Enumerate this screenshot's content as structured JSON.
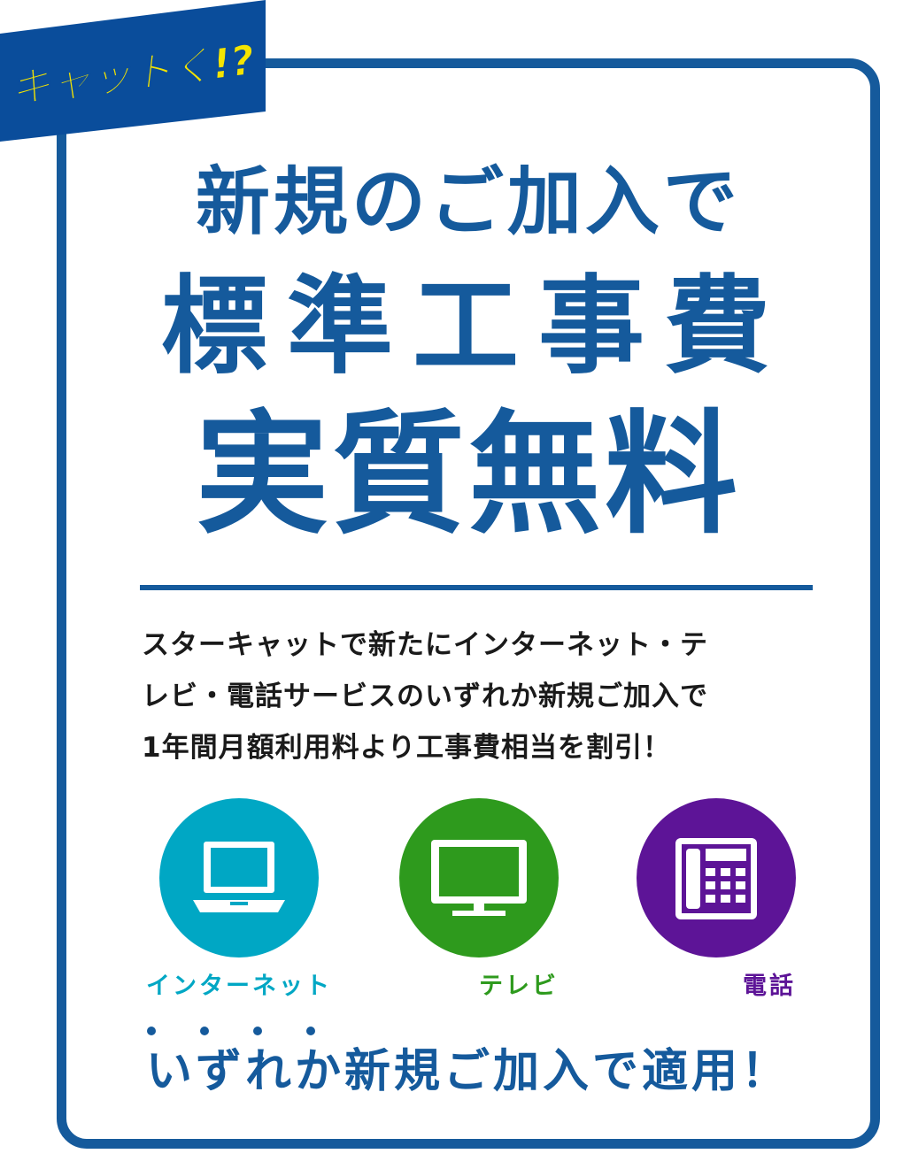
{
  "logo": {
    "text": "キャットく!?",
    "band_color": "#0a4d9b",
    "text_color": "#f4e400"
  },
  "headline": {
    "line1": "新規のご加入で",
    "line2": "標準工事費",
    "line3": "実質無料"
  },
  "description": {
    "lines": [
      "スターキャットで新たにインターネット・テ",
      "レビ・電話サービスのいずれか新規ご加入で",
      "1年間月額利用料より工事費相当を割引！"
    ]
  },
  "services": [
    {
      "label": "インターネット",
      "icon": "laptop-icon",
      "color": "#00a7c4"
    },
    {
      "label": "テレビ",
      "icon": "tv-icon",
      "color": "#2e9a1d"
    },
    {
      "label": "電話",
      "icon": "phone-icon",
      "color": "#5d1497"
    }
  ],
  "footer": {
    "text": "いずれか新規ご加入で適用！"
  },
  "colors": {
    "primary": "#155a9c"
  }
}
